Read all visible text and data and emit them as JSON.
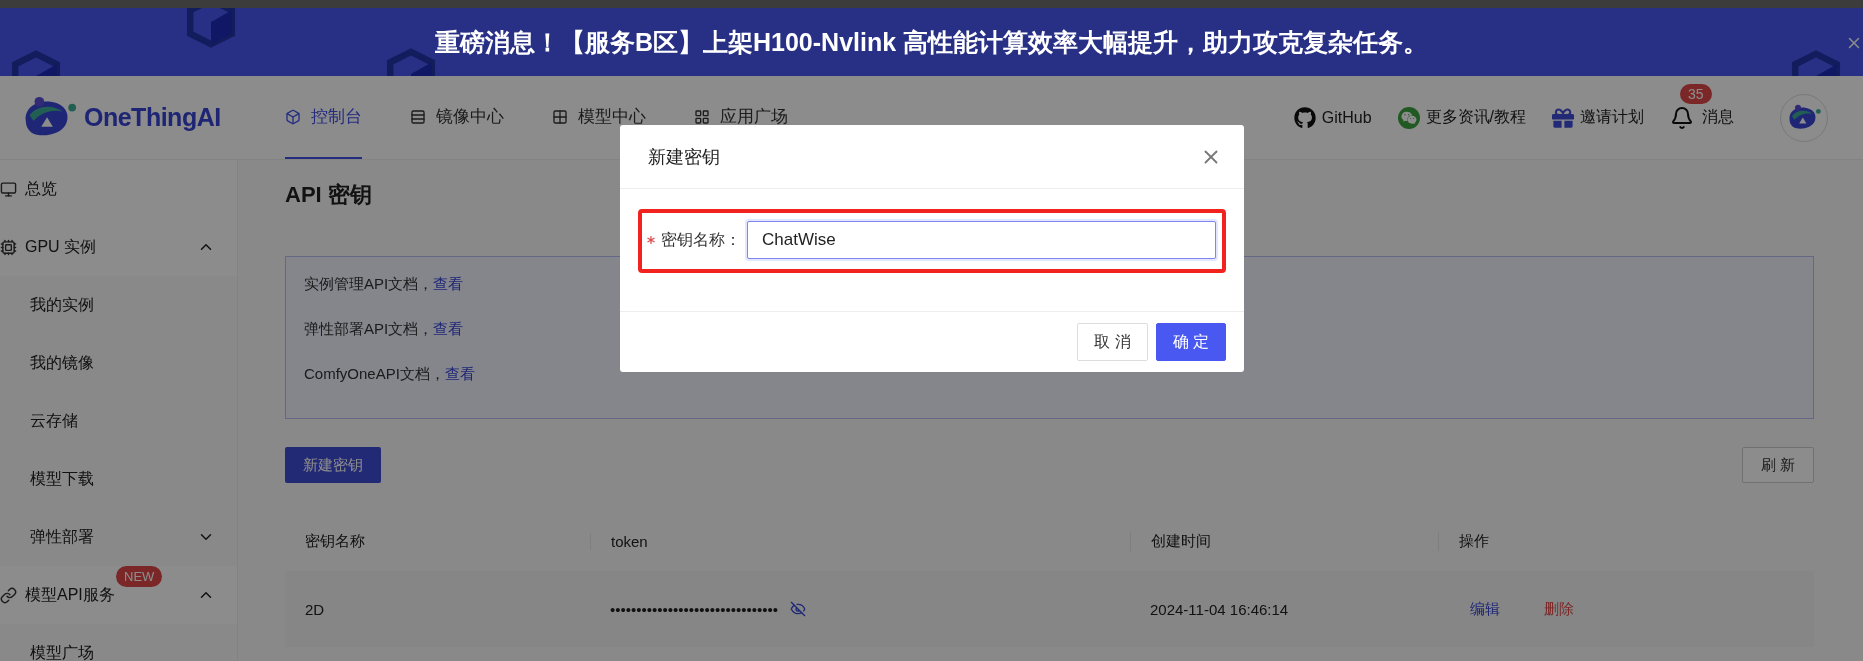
{
  "banner": {
    "text": "重磅消息！【服务B区】上架H100-Nvlink 高性能计算效率大幅提升，助力攻克复杂任务。"
  },
  "header": {
    "logo": "OneThingAI",
    "nav": [
      {
        "label": "控制台",
        "selected": true
      },
      {
        "label": "镜像中心",
        "selected": false
      },
      {
        "label": "模型中心",
        "selected": false
      },
      {
        "label": "应用广场",
        "selected": false
      }
    ],
    "links": [
      {
        "label": "GitHub"
      },
      {
        "label": "更多资讯/教程"
      },
      {
        "label": "邀请计划"
      }
    ],
    "messages": {
      "label": "消息",
      "badge": "35"
    }
  },
  "sidebar": {
    "items": [
      {
        "label": "总览"
      },
      {
        "label": "GPU 实例",
        "expanded": true,
        "children": [
          {
            "label": "我的实例"
          },
          {
            "label": "我的镜像"
          },
          {
            "label": "云存储"
          },
          {
            "label": "模型下载"
          },
          {
            "label": "弹性部署",
            "expanded": false
          }
        ]
      },
      {
        "label": "模型API服务",
        "badge": "NEW",
        "expanded": true,
        "children": [
          {
            "label": "模型广场"
          }
        ]
      }
    ]
  },
  "page": {
    "title": "API 密钥",
    "docs": [
      {
        "text": "实例管理API文档，",
        "link": "查看"
      },
      {
        "text": "弹性部署API文档，",
        "link": "查看"
      },
      {
        "text": "ComfyOneAPI文档，",
        "link": "查看"
      }
    ],
    "create_button": "新建密钥",
    "refresh_button": "刷 新",
    "table": {
      "columns": [
        "密钥名称",
        "token",
        "创建时间",
        "操作"
      ],
      "rows": [
        {
          "name": "2D",
          "token": "••••••••••••••••••••••••••••••••",
          "created": "2024-11-04 16:46:14",
          "actions": [
            {
              "label": "编辑",
              "kind": "edit"
            },
            {
              "label": "删除",
              "kind": "delete"
            }
          ]
        }
      ]
    }
  },
  "modal": {
    "title": "新建密钥",
    "field": {
      "label": "密钥名称：",
      "required": true,
      "value": "ChatWise",
      "highlighted": true
    },
    "buttons": [
      {
        "label": "取 消",
        "kind": "default"
      },
      {
        "label": "确 定",
        "kind": "primary"
      }
    ]
  }
}
